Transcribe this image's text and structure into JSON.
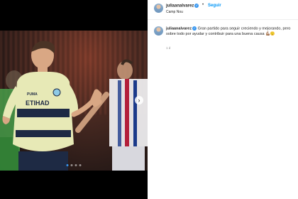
{
  "post": {
    "username": "juliaanalvarez",
    "follow_label": "Seguir",
    "location": "Camp Nou",
    "separator": "•",
    "caption": "Gran partido para seguir creciendo y mejorando, pero sobre todo por ayudar y contribuir para una buena causa 💪🏽🙂",
    "time_ago": "1 d",
    "carousel_count": 4,
    "carousel_active": 1
  },
  "photo": {
    "shirt_text_1": "ETIHAD",
    "shirt_text_2": "AIRWAYS"
  },
  "colors": {
    "accent": "#0095f6",
    "text": "#262626",
    "muted": "#8e8e8e"
  }
}
